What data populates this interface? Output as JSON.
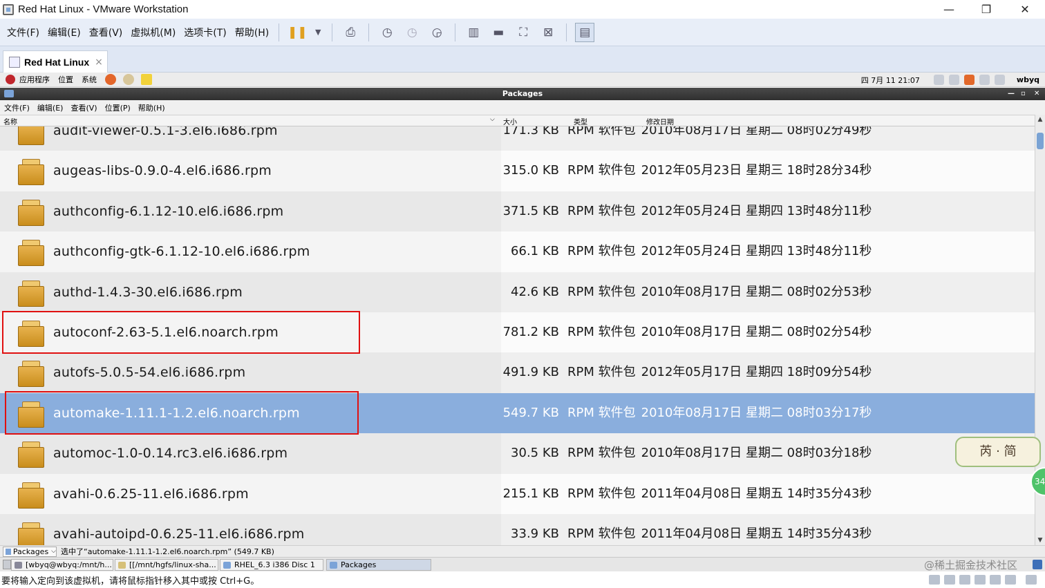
{
  "window": {
    "title": "Red Hat Linux - VMware Workstation"
  },
  "vm_menu": [
    "文件(F)",
    "编辑(E)",
    "查看(V)",
    "虚拟机(M)",
    "选项卡(T)",
    "帮助(H)"
  ],
  "toolbar_icons": [
    "pause-icon",
    "dropdown-icon",
    "send-ctrl-alt-del-icon",
    "snapshot-icon",
    "revert-snapshot-icon",
    "snapshot-manager-icon",
    "library-icon",
    "console-view-icon",
    "fullscreen-icon",
    "unity-icon",
    "thumbnail-icon"
  ],
  "vm_tab": {
    "label": "Red Hat Linux",
    "close": "×"
  },
  "gnome_panel": {
    "menus": [
      "应用程序",
      "位置",
      "系统"
    ],
    "clock": "四 7月 11 21:07",
    "user": "wbyq"
  },
  "nautilus": {
    "title": "Packages",
    "menu": [
      "文件(F)",
      "编辑(E)",
      "查看(V)",
      "位置(P)",
      "帮助(H)"
    ],
    "columns": {
      "name": "名称",
      "size": "大小",
      "type": "类型",
      "modified": "修改日期",
      "sort_indicator": "⌵"
    },
    "files": [
      {
        "name": "audit-viewer-0.5.1-3.el6.i686.rpm",
        "size": "171.3 KB",
        "type": "RPM 软件包",
        "date": "2010年08月17日 星期二 08时02分49秒"
      },
      {
        "name": "augeas-libs-0.9.0-4.el6.i686.rpm",
        "size": "315.0 KB",
        "type": "RPM 软件包",
        "date": "2012年05月23日 星期三 18时28分34秒"
      },
      {
        "name": "authconfig-6.1.12-10.el6.i686.rpm",
        "size": "371.5 KB",
        "type": "RPM 软件包",
        "date": "2012年05月24日 星期四 13时48分11秒"
      },
      {
        "name": "authconfig-gtk-6.1.12-10.el6.i686.rpm",
        "size": "66.1 KB",
        "type": "RPM 软件包",
        "date": "2012年05月24日 星期四 13时48分11秒"
      },
      {
        "name": "authd-1.4.3-30.el6.i686.rpm",
        "size": "42.6 KB",
        "type": "RPM 软件包",
        "date": "2010年08月17日 星期二 08时02分53秒"
      },
      {
        "name": "autoconf-2.63-5.1.el6.noarch.rpm",
        "size": "781.2 KB",
        "type": "RPM 软件包",
        "date": "2010年08月17日 星期二 08时02分54秒"
      },
      {
        "name": "autofs-5.0.5-54.el6.i686.rpm",
        "size": "491.9 KB",
        "type": "RPM 软件包",
        "date": "2012年05月17日 星期四 18时09分54秒"
      },
      {
        "name": "automake-1.11.1-1.2.el6.noarch.rpm",
        "size": "549.7 KB",
        "type": "RPM 软件包",
        "date": "2010年08月17日 星期二 08时03分17秒",
        "selected": true
      },
      {
        "name": "automoc-1.0-0.14.rc3.el6.i686.rpm",
        "size": "30.5 KB",
        "type": "RPM 软件包",
        "date": "2010年08月17日 星期二 08时03分18秒"
      },
      {
        "name": "avahi-0.6.25-11.el6.i686.rpm",
        "size": "215.1 KB",
        "type": "RPM 软件包",
        "date": "2011年04月08日 星期五 14时35分43秒"
      },
      {
        "name": "avahi-autoipd-0.6.25-11.el6.i686.rpm",
        "size": "33.9 KB",
        "type": "RPM 软件包",
        "date": "2011年04月08日 星期五 14时35分43秒"
      }
    ],
    "status": {
      "location": "Packages",
      "message": "选中了“automake-1.11.1-1.2.el6.noarch.rpm” (549.7 KB)"
    }
  },
  "taskbar": {
    "items": [
      "[wbyq@wbyq:/mnt/h...",
      "[[/mnt/hgfs/linux-sha...",
      "RHEL_6.3 i386 Disc 1",
      "Packages"
    ],
    "watermark": "@稀土掘金技术社区"
  },
  "vm_status": {
    "hint": "要将输入定向到该虚拟机，请将鼠标指针移入其中或按 Ctrl+G。"
  },
  "overlay": {
    "sticker_text": "芮 · 简",
    "badge_text": "34"
  },
  "colors": {
    "selection": "#8aaedd",
    "highlight_box": "#e01010",
    "menubar_bg": "#e8eef8"
  }
}
